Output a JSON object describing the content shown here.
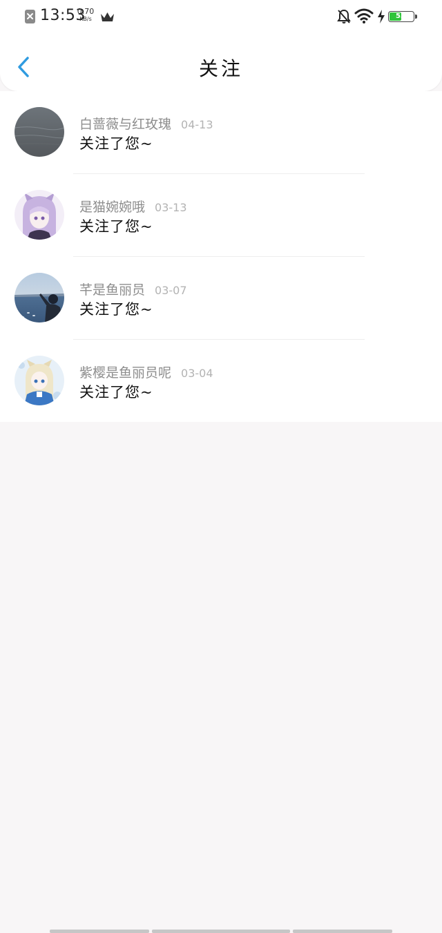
{
  "status_bar": {
    "time": "13:53",
    "network_speed_value": "0.70",
    "network_speed_unit": "KB/s",
    "battery_level": "53",
    "battery_percent": 53,
    "battery_color": "#2fc43a",
    "icons": [
      "sim-error-icon",
      "crown-icon",
      "bell-off-icon",
      "wifi-icon",
      "charging-icon",
      "battery-icon"
    ]
  },
  "header": {
    "title": "关注",
    "back_icon": "chevron-left-icon",
    "accent_color": "#2f9be0"
  },
  "follows": [
    {
      "name": "白蔷薇与红玫瑰",
      "date": "04-13",
      "message": "关注了您~",
      "avatar": "grey-sea-photo"
    },
    {
      "name": "是猫婉婉哦",
      "date": "03-13",
      "message": "关注了您~",
      "avatar": "anime-girl-purple-hood"
    },
    {
      "name": "芊是鱼丽员",
      "date": "03-07",
      "message": "关注了您~",
      "avatar": "person-pointing-at-sea"
    },
    {
      "name": "紫樱是鱼丽员呢",
      "date": "03-04",
      "message": "关注了您~",
      "avatar": "anime-girl-blue-outfit"
    }
  ]
}
